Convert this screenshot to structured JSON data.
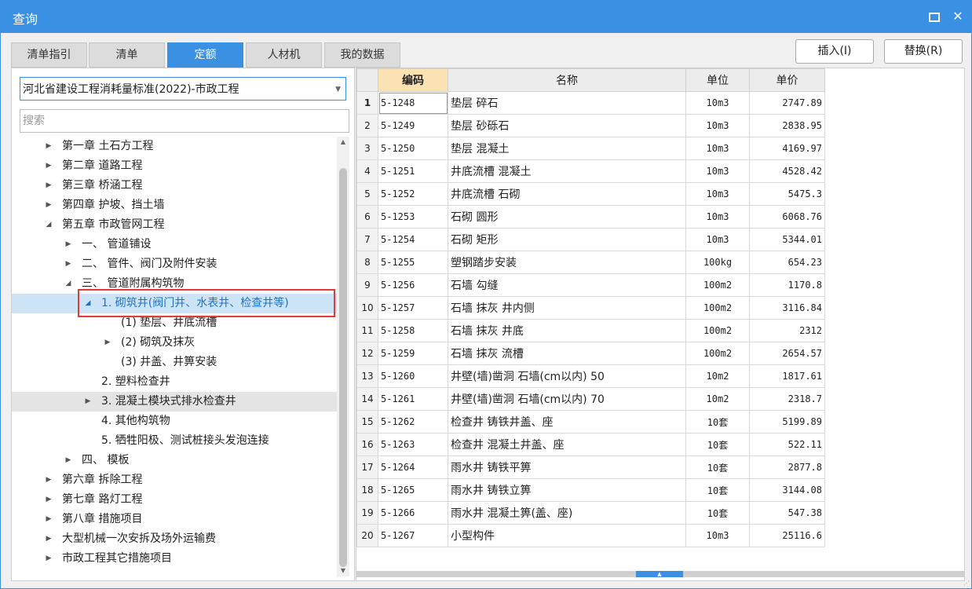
{
  "window": {
    "title": "查询"
  },
  "tabs": [
    {
      "label": "清单指引",
      "active": false
    },
    {
      "label": "清单",
      "active": false
    },
    {
      "label": "定额",
      "active": true
    },
    {
      "label": "人材机",
      "active": false
    },
    {
      "label": "我的数据",
      "active": false
    }
  ],
  "buttons": {
    "insert": "插入(I)",
    "replace": "替换(R)"
  },
  "left": {
    "library": "河北省建设工程消耗量标准(2022)-市政工程",
    "search_placeholder": "搜索",
    "tree": [
      {
        "label": "第一章 土石方工程",
        "toggle": "▶",
        "level": 0
      },
      {
        "label": "第二章 道路工程",
        "toggle": "▶",
        "level": 0
      },
      {
        "label": "第三章 桥涵工程",
        "toggle": "▶",
        "level": 0
      },
      {
        "label": "第四章 护坡、挡土墙",
        "toggle": "▶",
        "level": 0
      },
      {
        "label": "第五章 市政管网工程",
        "toggle": "◢",
        "level": 0
      },
      {
        "label": "一、 管道铺设",
        "toggle": "▶",
        "level": 1
      },
      {
        "label": "二、 管件、阀门及附件安装",
        "toggle": "▶",
        "level": 1
      },
      {
        "label": "三、 管道附属构筑物",
        "toggle": "◢",
        "level": 1
      },
      {
        "label": "1. 砌筑井(阀门井、水表井、检查井等)",
        "toggle": "◢",
        "level": 2,
        "state": "selected"
      },
      {
        "label": "(1) 垫层、井底流槽",
        "toggle": "",
        "level": 3
      },
      {
        "label": "(2) 砌筑及抹灰",
        "toggle": "▶",
        "level": 3
      },
      {
        "label": "(3) 井盖、井箅安装",
        "toggle": "",
        "level": 3
      },
      {
        "label": "2. 塑料检查井",
        "toggle": "",
        "level": 2
      },
      {
        "label": "3. 混凝土模块式排水检查井",
        "toggle": "▶",
        "level": 2,
        "state": "hover"
      },
      {
        "label": "4. 其他构筑物",
        "toggle": "",
        "level": 2
      },
      {
        "label": "5. 牺牲阳极、测试桩接头发泡连接",
        "toggle": "",
        "level": 2
      },
      {
        "label": "四、 模板",
        "toggle": "▶",
        "level": 1
      },
      {
        "label": "第六章 拆除工程",
        "toggle": "▶",
        "level": 0
      },
      {
        "label": "第七章 路灯工程",
        "toggle": "▶",
        "level": 0
      },
      {
        "label": "第八章 措施项目",
        "toggle": "▶",
        "level": 0
      },
      {
        "label": "大型机械一次安拆及场外运输费",
        "toggle": "▶",
        "level": 0
      },
      {
        "label": "市政工程其它措施项目",
        "toggle": "▶",
        "level": 0
      }
    ]
  },
  "table": {
    "headers": {
      "code": "编码",
      "name": "名称",
      "unit": "单位",
      "price": "单价"
    },
    "rows": [
      {
        "idx": "1",
        "code": "5-1248",
        "name": "垫层 碎石",
        "unit": "10m3",
        "price": "2747.89"
      },
      {
        "idx": "2",
        "code": "5-1249",
        "name": "垫层 砂砾石",
        "unit": "10m3",
        "price": "2838.95"
      },
      {
        "idx": "3",
        "code": "5-1250",
        "name": "垫层 混凝土",
        "unit": "10m3",
        "price": "4169.97"
      },
      {
        "idx": "4",
        "code": "5-1251",
        "name": "井底流槽 混凝土",
        "unit": "10m3",
        "price": "4528.42"
      },
      {
        "idx": "5",
        "code": "5-1252",
        "name": "井底流槽 石砌",
        "unit": "10m3",
        "price": "5475.3"
      },
      {
        "idx": "6",
        "code": "5-1253",
        "name": "石砌 圆形",
        "unit": "10m3",
        "price": "6068.76"
      },
      {
        "idx": "7",
        "code": "5-1254",
        "name": "石砌 矩形",
        "unit": "10m3",
        "price": "5344.01"
      },
      {
        "idx": "8",
        "code": "5-1255",
        "name": "塑钢踏步安装",
        "unit": "100kg",
        "price": "654.23"
      },
      {
        "idx": "9",
        "code": "5-1256",
        "name": "石墙 勾缝",
        "unit": "100m2",
        "price": "1170.8"
      },
      {
        "idx": "10",
        "code": "5-1257",
        "name": "石墙 抹灰 井内侧",
        "unit": "100m2",
        "price": "3116.84"
      },
      {
        "idx": "11",
        "code": "5-1258",
        "name": "石墙 抹灰 井底",
        "unit": "100m2",
        "price": "2312"
      },
      {
        "idx": "12",
        "code": "5-1259",
        "name": "石墙 抹灰 流槽",
        "unit": "100m2",
        "price": "2654.57"
      },
      {
        "idx": "13",
        "code": "5-1260",
        "name": "井壁(墙)凿洞 石墙(cm以内) 50",
        "unit": "10m2",
        "price": "1817.61"
      },
      {
        "idx": "14",
        "code": "5-1261",
        "name": "井壁(墙)凿洞 石墙(cm以内) 70",
        "unit": "10m2",
        "price": "2318.7"
      },
      {
        "idx": "15",
        "code": "5-1262",
        "name": "检查井 铸铁井盖、座",
        "unit": "10套",
        "price": "5199.89"
      },
      {
        "idx": "16",
        "code": "5-1263",
        "name": "检查井 混凝土井盖、座",
        "unit": "10套",
        "price": "522.11"
      },
      {
        "idx": "17",
        "code": "5-1264",
        "name": "雨水井 铸铁平箅",
        "unit": "10套",
        "price": "2877.8"
      },
      {
        "idx": "18",
        "code": "5-1265",
        "name": "雨水井 铸铁立箅",
        "unit": "10套",
        "price": "3144.08"
      },
      {
        "idx": "19",
        "code": "5-1266",
        "name": "雨水井 混凝土箅(盖、座)",
        "unit": "10套",
        "price": "547.38"
      },
      {
        "idx": "20",
        "code": "5-1267",
        "name": "小型构件",
        "unit": "10m3",
        "price": "25116.6"
      }
    ]
  },
  "icons": {
    "maximize": "maximize-icon",
    "close": "close-icon",
    "close_glyph": "✕",
    "dropdown": "chevron-down-icon",
    "dropdown_glyph": "▼",
    "scroll_up_glyph": "▲",
    "scroll_down_glyph": "▼",
    "grip_glyph": "▲",
    "resize_glyph": "⋰"
  },
  "colors": {
    "accent": "#3a90e3",
    "header_code": "#fbe2b3",
    "selection": "#cde4f7",
    "highlight_box": "#e03b3b"
  }
}
